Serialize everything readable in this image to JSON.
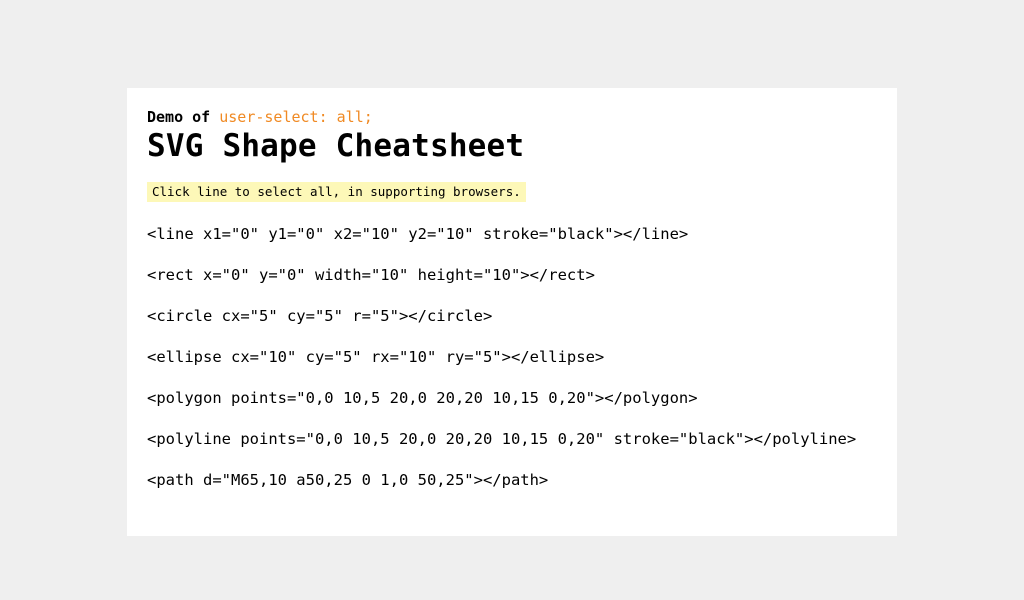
{
  "header": {
    "demo_prefix": "Demo of",
    "demo_property": "user-select: all;",
    "title": "SVG Shape Cheatsheet",
    "note": "Click line to select all, in supporting browsers."
  },
  "snippets": [
    "<line x1=\"0\" y1=\"0\" x2=\"10\" y2=\"10\" stroke=\"black\"></line>",
    "<rect x=\"0\" y=\"0\" width=\"10\" height=\"10\"></rect>",
    "<circle cx=\"5\" cy=\"5\" r=\"5\"></circle>",
    "<ellipse cx=\"10\" cy=\"5\" rx=\"10\" ry=\"5\"></ellipse>",
    "<polygon points=\"0,0 10,5 20,0 20,20 10,15 0,20\"></polygon>",
    "<polyline points=\"0,0 10,5 20,0 20,20 10,15 0,20\" stroke=\"black\"></polyline>",
    "<path d=\"M65,10 a50,25 0 1,0 50,25\"></path>"
  ],
  "colors": {
    "page_background": "#efefef",
    "card_background": "#ffffff",
    "accent": "#f08a24",
    "note_highlight": "#fdf8b8"
  }
}
